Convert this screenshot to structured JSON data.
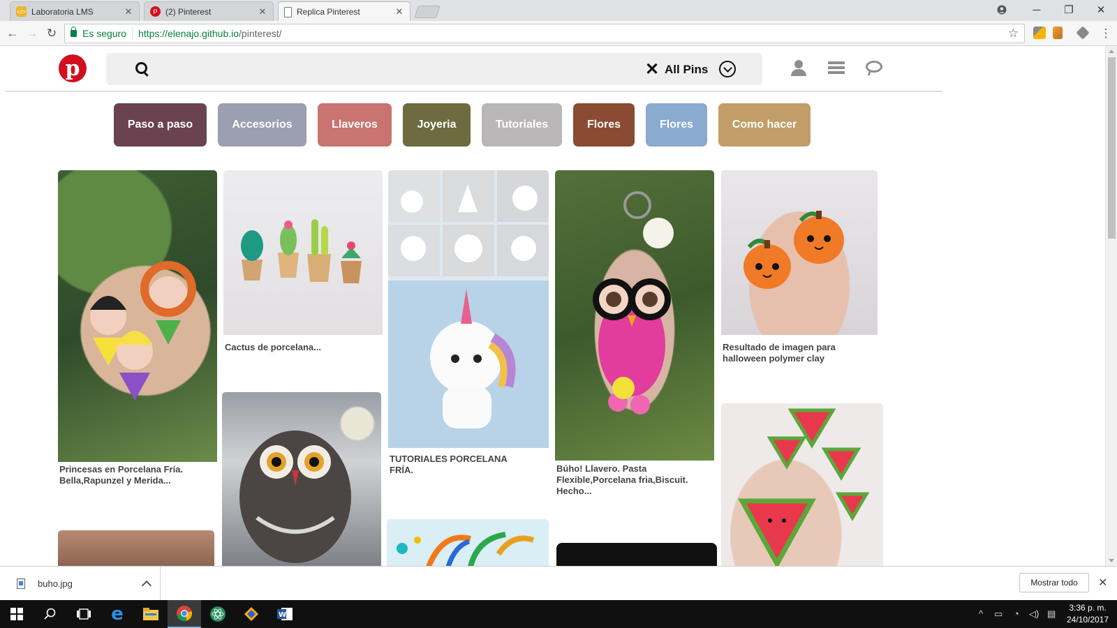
{
  "browser": {
    "tabs": [
      {
        "label": "Laboratoria LMS",
        "color": "#f0b429",
        "glyph": "</>"
      },
      {
        "label": "(2) Pinterest",
        "color": "#d1101f",
        "glyph": "P"
      },
      {
        "label": "Replica Pinterest",
        "color": "#ffffff",
        "glyph": ""
      }
    ],
    "secure_label": "Es seguro",
    "url_scheme_host": "https://elenajo.github.io",
    "url_path": "/pinterest/"
  },
  "page": {
    "logo_glyph": "p",
    "search": {
      "placeholder": "",
      "filter_label": "All Pins"
    },
    "categories": [
      {
        "label": "Paso a paso",
        "color": "#6b4350"
      },
      {
        "label": "Accesorios",
        "color": "#9a9fb1"
      },
      {
        "label": "Llaveros",
        "color": "#c97471"
      },
      {
        "label": "Joyeria",
        "color": "#6d6b3f"
      },
      {
        "label": "Tutoriales",
        "color": "#b9b6b8"
      },
      {
        "label": "Flores",
        "color": "#8b4b33"
      },
      {
        "label": "Flores",
        "color": "#8aaad0"
      },
      {
        "label": "Como hacer",
        "color": "#c19e68"
      }
    ],
    "pins": [
      {
        "caption": "Princesas en Porcelana Fría. Bella,Rapunzel y Merida...",
        "bg": "#4a6a3c"
      },
      {
        "caption": "Cactus de porcelana...",
        "bg": "#e8e4e6"
      },
      {
        "caption": "TUTORIALES PORCELANA FRÍA.",
        "bg": "#b8d3e8"
      },
      {
        "caption": "Búho! Llavero. Pasta Flexible,Porcelana fria,Biscuit. Hecho...",
        "bg": "#5b6f3c"
      },
      {
        "caption": "Resultado de imagen para halloween polymer clay",
        "bg": "#e9d3c6"
      },
      {
        "caption": "",
        "bg": "#c9a98f"
      },
      {
        "caption": "",
        "bg": "#c7c7c7"
      },
      {
        "caption": "",
        "bg": "#d9eef5"
      },
      {
        "caption": "",
        "bg": "#111111"
      },
      {
        "caption": "",
        "bg": "#efeaea"
      }
    ]
  },
  "downloads": {
    "file": "buho.jpg",
    "show_all": "Mostrar todo"
  },
  "taskbar": {
    "time": "3:36 p. m.",
    "date": "24/10/2017"
  }
}
